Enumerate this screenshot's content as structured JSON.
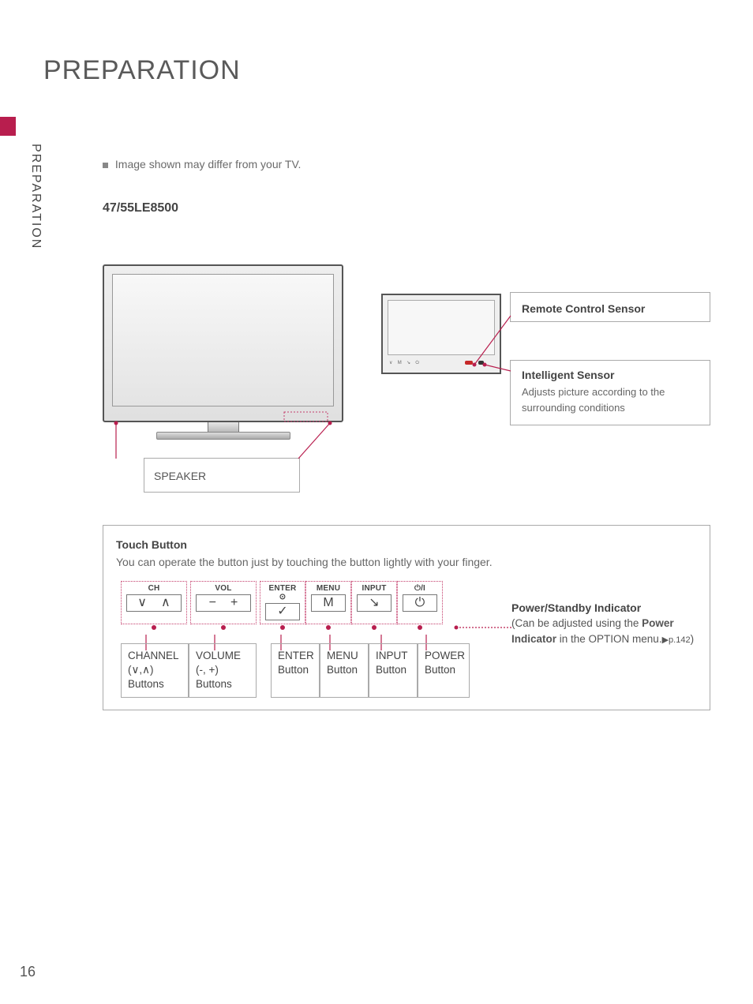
{
  "page": {
    "title": "PREPARATION",
    "sideTab": "PREPARATION",
    "note": "Image shown may differ from your TV.",
    "model": "47/55LE8500",
    "number": "16"
  },
  "tv": {
    "speakerLabel": "SPEAKER"
  },
  "callouts": {
    "remote": "Remote Control Sensor",
    "intelligentTitle": "Intelligent Sensor",
    "intelligentDesc": "Adjusts picture according to the surrounding conditions"
  },
  "touch": {
    "title": "Touch Button",
    "desc": "You can operate the button just by touching the button lightly with your finger.",
    "headers": {
      "ch": "CH",
      "vol": "VOL",
      "enter": "ENTER",
      "menu": "MENU",
      "input": "INPUT",
      "power": "⏻/I"
    },
    "labels": {
      "channel": {
        "l1": "CHANNEL",
        "l2": "(∨,∧)",
        "l3": "Buttons"
      },
      "volume": {
        "l1": "VOLUME",
        "l2": "(-, +)",
        "l3": "Buttons"
      },
      "enter": {
        "l1": "ENTER",
        "l2": "Button"
      },
      "menu": {
        "l1": "MENU",
        "l2": "Button"
      },
      "input": {
        "l1": "INPUT",
        "l2": "Button"
      },
      "power": {
        "l1": "POWER",
        "l2": "Button"
      }
    },
    "powerIndicator": {
      "title": "Power/Standby Indicator",
      "line1": "(Can be adjusted using the ",
      "bold": "Power Indicator",
      "line2": " in the OPTION menu.",
      "ref": "▶p.142",
      "close": ")"
    }
  }
}
